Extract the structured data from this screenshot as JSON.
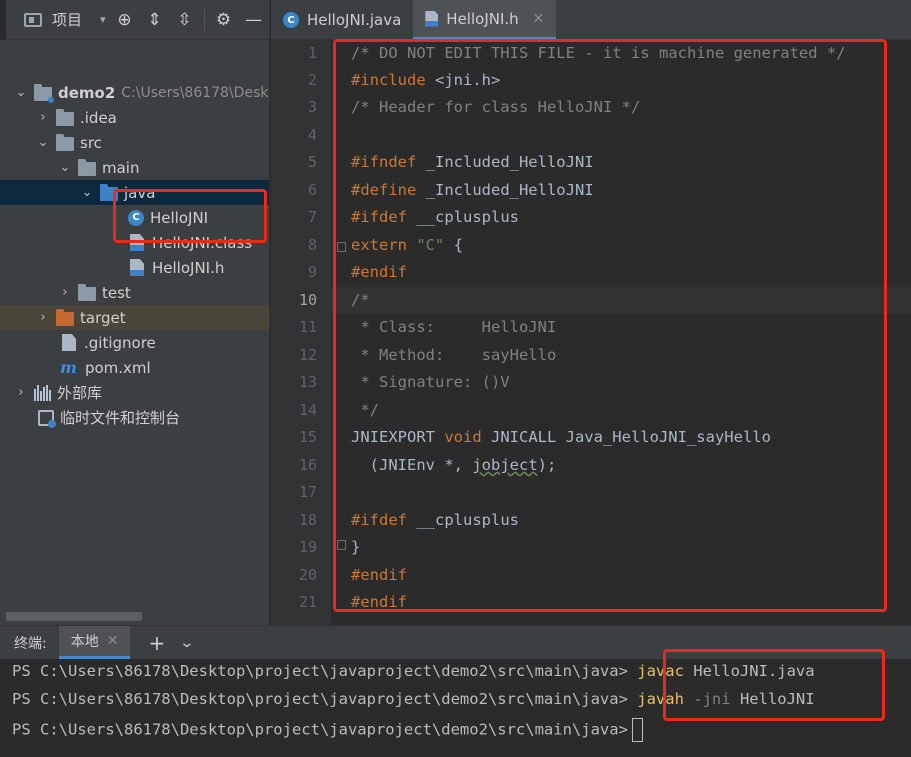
{
  "project_panel": {
    "title": "项目",
    "tree": [
      {
        "label": "demo2",
        "path": "C:\\Users\\86178\\Desk"
      },
      {
        "label": ".idea"
      },
      {
        "label": "src"
      },
      {
        "label": "main"
      },
      {
        "label": "java"
      },
      {
        "label": "HelloJNI"
      },
      {
        "label": "HelloJNI.class"
      },
      {
        "label": "HelloJNI.h"
      },
      {
        "label": "test"
      },
      {
        "label": "target"
      },
      {
        "label": ".gitignore"
      },
      {
        "label": "pom.xml"
      },
      {
        "label": "外部库"
      },
      {
        "label": "临时文件和控制台"
      }
    ]
  },
  "editor": {
    "tabs": [
      {
        "label": "HelloJNI.java",
        "icon": "java-class-icon"
      },
      {
        "label": "HelloJNI.h",
        "icon": "header-file-icon",
        "active": true
      }
    ],
    "line_numbers": [
      "1",
      "2",
      "3",
      "4",
      "5",
      "6",
      "7",
      "8",
      "9",
      "10",
      "11",
      "12",
      "13",
      "14",
      "15",
      "16",
      "17",
      "18",
      "19",
      "20",
      "21"
    ],
    "current_line": "10",
    "code": [
      "/* DO NOT EDIT THIS FILE - it is machine generated */",
      "#include <jni.h>",
      "/* Header for class HelloJNI */",
      "",
      "#ifndef _Included_HelloJNI",
      "#define _Included_HelloJNI",
      "#ifdef __cplusplus",
      "extern \"C\" {",
      "#endif",
      "/*",
      " * Class:     HelloJNI",
      " * Method:    sayHello",
      " * Signature: ()V",
      " */",
      "JNIEXPORT void JNICALL Java_HelloJNI_sayHello",
      "  (JNIEnv *, jobject);",
      "",
      "#ifdef __cplusplus",
      "}",
      "#endif",
      "#endif"
    ]
  },
  "terminal": {
    "label": "终端:",
    "tab": "本地",
    "prompt": "PS C:\\Users\\86178\\Desktop\\project\\javaproject\\demo2\\src\\main\\java>",
    "lines": [
      {
        "cmd": "javac",
        "flag": "",
        "arg": "HelloJNI.java"
      },
      {
        "cmd": "javah",
        "flag": "-jni",
        "arg": "HelloJNI"
      }
    ]
  },
  "colors": {
    "highlight_box": "#e8291c",
    "selection": "#0d293e",
    "accent": "#4a88c7"
  }
}
